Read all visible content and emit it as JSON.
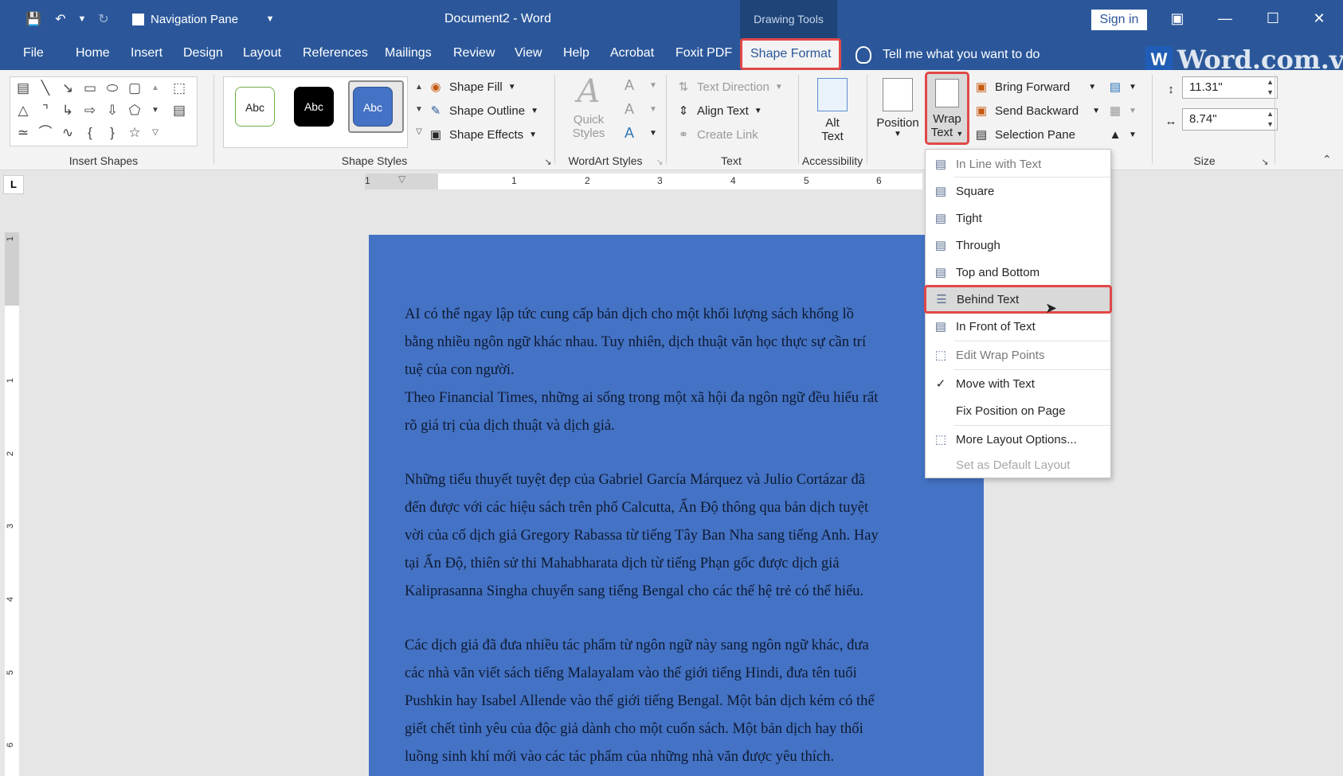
{
  "titlebar": {
    "nav_pane_label": "Navigation Pane",
    "doc_title": "Document2  -  Word",
    "context_tab_group": "Drawing Tools",
    "sign_in": "Sign in"
  },
  "tabs": [
    "File",
    "Home",
    "Insert",
    "Design",
    "Layout",
    "References",
    "Mailings",
    "Review",
    "View",
    "Help",
    "Acrobat",
    "Foxit PDF",
    "Shape Format"
  ],
  "tell_me": "Tell me what you want to do",
  "watermark": "Word.com.vn",
  "ribbon": {
    "insert_shapes_label": "Insert Shapes",
    "shape_styles_label": "Shape Styles",
    "abc_samples": [
      "Abc",
      "Abc",
      "Abc"
    ],
    "shape_fill": "Shape Fill",
    "shape_outline": "Shape Outline",
    "shape_effects": "Shape Effects",
    "quick_styles_line1": "Quick",
    "quick_styles_line2": "Styles",
    "wordart_label": "WordArt Styles",
    "text_direction": "Text Direction",
    "align_text": "Align Text",
    "create_link": "Create Link",
    "text_label": "Text",
    "alt_text_line1": "Alt",
    "alt_text_line2": "Text",
    "accessibility_label": "Accessibility",
    "position": "Position",
    "wrap_line1": "Wrap",
    "wrap_line2": "Text",
    "bring_forward": "Bring Forward",
    "send_backward": "Send Backward",
    "selection_pane": "Selection Pane",
    "height_value": "11.31\"",
    "width_value": "8.74\"",
    "size_label": "Size"
  },
  "ruler_numbers": [
    "1",
    "1",
    "2",
    "3",
    "4",
    "5",
    "6"
  ],
  "vruler_numbers": [
    "1",
    "1",
    "2",
    "3",
    "4",
    "5",
    "6"
  ],
  "document": {
    "para1_line1": "AI có thể ngay lập tức cung cấp bản dịch cho một khối lượng sách khổng lồ",
    "para1_line2": "bằng nhiều ngôn ngữ khác nhau. Tuy nhiên, dịch thuật văn học thực sự cần trí",
    "para1_line3": "tuệ của con người.",
    "para2_line1": "Theo Financial Times, những ai sống trong một xã hội đa ngôn ngữ đều hiểu rất",
    "para2_line2": "rõ giá trị của dịch thuật và dịch giả.",
    "para3_line1": "Những tiểu thuyết tuyệt đẹp của Gabriel García Márquez và Julio Cortázar đã",
    "para3_line2": "đến được với các hiệu sách trên phố Calcutta, Ấn Độ thông qua bản dịch tuyệt",
    "para3_line3": "vời của cố dịch giả Gregory Rabassa từ tiếng Tây Ban Nha sang tiếng Anh. Hay",
    "para3_line4": "tại Ấn Độ, thiên sử thi Mahabharata dịch từ tiếng Phạn gốc được dịch giả",
    "para3_line5": "Kaliprasanna Singha chuyển sang tiếng Bengal cho các thế hệ trẻ có thể hiểu.",
    "para4_line1": "Các dịch giả đã đưa nhiều tác phẩm từ ngôn ngữ này sang ngôn ngữ khác, đưa",
    "para4_line2": "các nhà văn viết sách tiếng Malayalam vào thế giới tiếng Hindi, đưa tên tuổi",
    "para4_line3": "Pushkin hay Isabel Allende vào thế giới tiếng Bengal. Một bản dịch kém có thể",
    "para4_line4": "giết chết tình yêu của độc giả dành cho một cuốn sách. Một bản dịch hay thổi",
    "para4_line5": "luồng sinh khí mới vào các tác phẩm của những nhà văn được yêu thích."
  },
  "wrap_menu": {
    "in_line": "In Line with Text",
    "square": "Square",
    "tight": "Tight",
    "through": "Through",
    "top_bottom": "Top and Bottom",
    "behind": "Behind Text",
    "in_front": "In Front of Text",
    "edit_points": "Edit Wrap Points",
    "move_with": "Move with Text",
    "fix_position": "Fix Position on Page",
    "more_options": "More Layout Options...",
    "set_default": "Set as Default Layout"
  },
  "colors": {
    "title_blue": "#2b579a",
    "page_fill": "#4472c4",
    "highlight_red": "#e04848"
  }
}
